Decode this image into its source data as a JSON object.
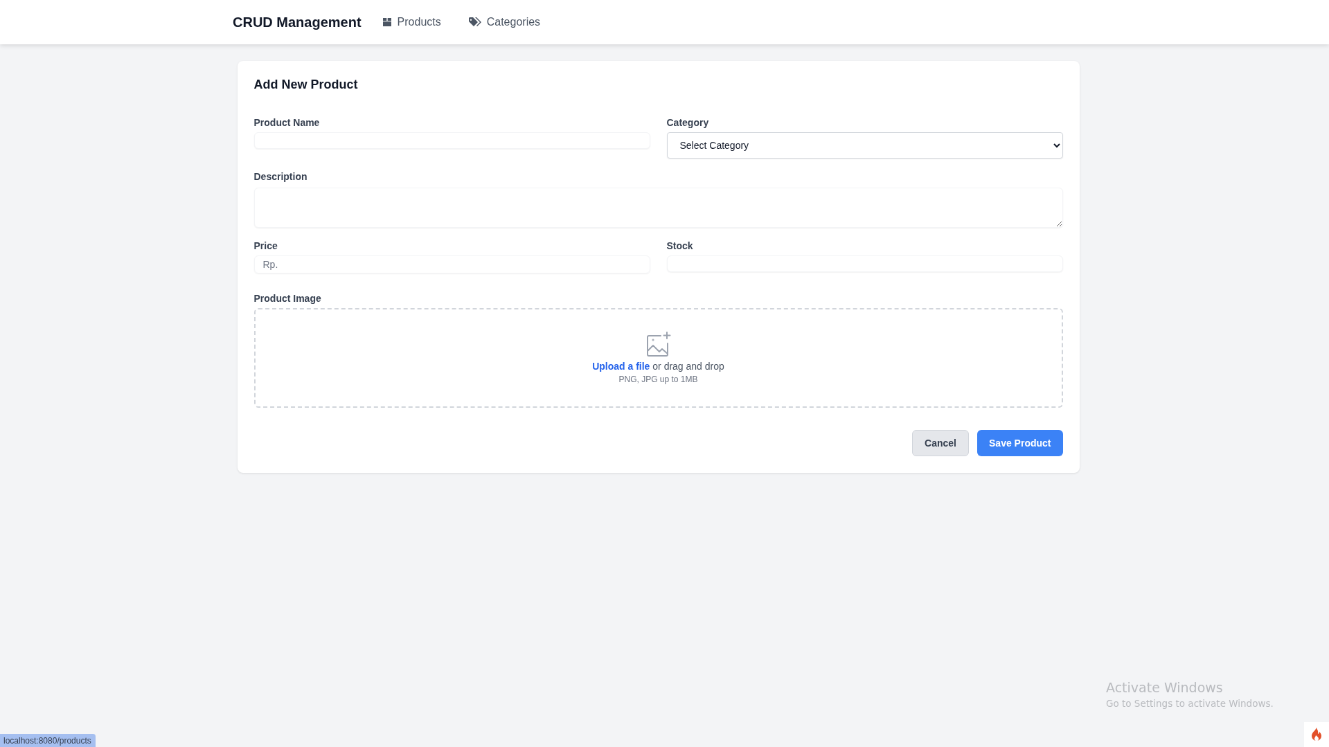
{
  "navbar": {
    "brand": "CRUD Management",
    "links": [
      {
        "label": "Products",
        "kind": "box"
      },
      {
        "label": "Categories",
        "kind": "tags"
      }
    ]
  },
  "form": {
    "title": "Add New Product",
    "fields": [
      {
        "kind": "text",
        "label": "Product Name"
      },
      {
        "kind": "select",
        "label": "Category",
        "value": "Select Category"
      },
      {
        "kind": "textarea",
        "label": "Description"
      },
      {
        "kind": "prefixed",
        "label": "Price",
        "prefix": "Rp."
      },
      {
        "kind": "text",
        "label": "Stock"
      }
    ],
    "image": {
      "label": "Product Image",
      "link": "Upload a file",
      "text": "or drag and drop",
      "hint": "PNG, JPG up to 1MB"
    },
    "buttons": [
      {
        "label": "Cancel",
        "kind": "secondary"
      },
      {
        "label": "Save Product",
        "kind": "primary"
      }
    ]
  },
  "status_url": "localhost:8080/products",
  "os_notice": {
    "title": "Activate Windows",
    "subtitle": "Go to Settings to activate Windows."
  }
}
